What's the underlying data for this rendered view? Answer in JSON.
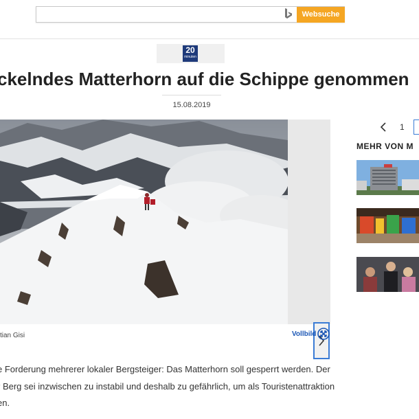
{
  "search": {
    "placeholder": "",
    "button_label": "Websuche",
    "logo": "bing-icon"
  },
  "source": {
    "logo_text": "20",
    "logo_sub": "minuten"
  },
  "article": {
    "headline": "ckelndes Matterhorn auf die Schippe genommen",
    "date": "15.08.2019",
    "photo_caption": "tian Gisi",
    "fullscreen_label": "Vollbild",
    "body": [
      "e Forderung mehrerer lokaler Bergsteiger: Das Matterhorn soll gesperrt werden. Der",
      "r Berg sei inzwischen zu instabil und deshalb zu gefährlich, um als Touristenattraktion",
      "en."
    ]
  },
  "sidebar": {
    "pager": {
      "page": "1"
    },
    "more_heading": "MEHR VON M",
    "thumbnails": [
      "building-photo",
      "playground-photo",
      "people-photo"
    ]
  },
  "colors": {
    "accent": "#f5a623",
    "link": "#1a56b5",
    "focus": "#3a7bd5"
  }
}
